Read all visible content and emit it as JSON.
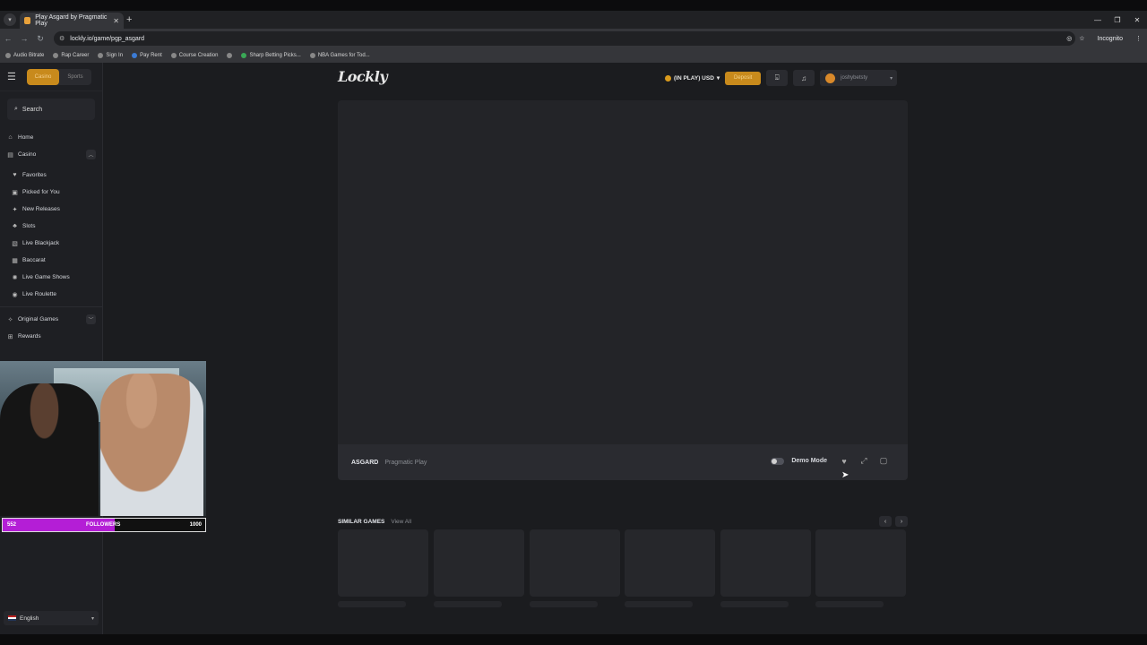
{
  "browser": {
    "tab_title": "Play Asgard by Pragmatic Play",
    "url": "lockly.io/game/pgp_asgard",
    "incognito_label": "Incognito",
    "bookmarks": [
      "Audio Bitrate",
      "Rap Career",
      "Sign In",
      "Pay Rent",
      "Course Creation",
      "",
      "Sharp Betting Picks...",
      "NBA Games for Tod..."
    ]
  },
  "sidebar": {
    "switch": {
      "casino": "Casino",
      "sports": "Sports"
    },
    "search_placeholder": "Search",
    "home": "Home",
    "casino": "Casino",
    "casino_items": [
      "Favorites",
      "Picked for You",
      "New Releases",
      "Slots",
      "Live Blackjack",
      "Baccarat",
      "Live Game Shows",
      "Live Roulette"
    ],
    "original_games": "Original Games",
    "rewards": "Rewards",
    "language": "English"
  },
  "header": {
    "logo": "Lockly",
    "balance_label": "(IN PLAY) USD",
    "deposit_label": "Deposit",
    "username": "joshybetsty"
  },
  "game": {
    "title": "ASGARD",
    "provider": "Pragmatic Play",
    "demo_label": "Demo Mode",
    "demo_on": false
  },
  "similar": {
    "title": "SIMILAR GAMES",
    "view_all": "View All"
  },
  "stream_overlay": {
    "current": "552",
    "label": "FOLLOWERS",
    "goal": "1000",
    "progress": 0.552
  }
}
